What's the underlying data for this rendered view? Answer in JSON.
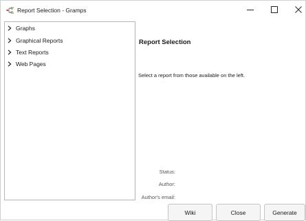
{
  "window": {
    "title": "Report Selection - Gramps",
    "app_icon": "gramps-tree-icon",
    "controls": {
      "minimize_icon": "minimize-icon",
      "maximize_icon": "maximize-icon",
      "close_icon": "close-icon"
    }
  },
  "tree": {
    "items": [
      {
        "label": "Graphs",
        "icon": "chevron-right-icon"
      },
      {
        "label": "Graphical Reports",
        "icon": "chevron-right-icon"
      },
      {
        "label": "Text Reports",
        "icon": "chevron-right-icon"
      },
      {
        "label": "Web Pages",
        "icon": "chevron-right-icon"
      }
    ]
  },
  "content": {
    "title": "Report Selection",
    "description": "Select a report from those available on the left.",
    "status_label": "Status:",
    "author_label": "Author:",
    "author_email_label": "Author's email:"
  },
  "buttons": {
    "wiki": "Wiki",
    "close": "Close",
    "generate": "Generate"
  },
  "colors": {
    "background": "#ffffff",
    "border": "#b4b4b4",
    "button_bg": "#f5f5f5"
  }
}
